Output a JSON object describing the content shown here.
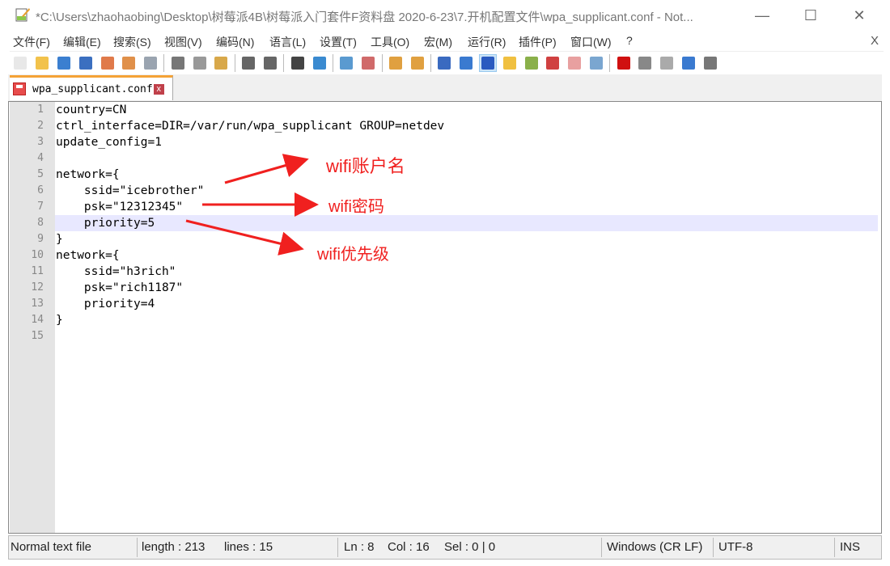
{
  "window": {
    "title": "*C:\\Users\\zhaohaobing\\Desktop\\树莓派4B\\树莓派入门套件F资料盘 2020-6-23\\7.开机配置文件\\wpa_supplicant.conf - Not...",
    "minimize": "—",
    "maximize": "☐",
    "close": "✕"
  },
  "menu": [
    "文件(F)",
    "编辑(E)",
    "搜索(S)",
    "视图(V)",
    "编码(N)",
    "语言(L)",
    "设置(T)",
    "工具(O)",
    "宏(M)",
    "运行(R)",
    "插件(P)",
    "窗口(W)",
    "?"
  ],
  "menu_close": "X",
  "toolbar": [
    {
      "name": "new-file-icon",
      "color": "#e8e8e8"
    },
    {
      "name": "open-file-icon",
      "color": "#f2c24b"
    },
    {
      "name": "save-icon",
      "color": "#3b7fd0"
    },
    {
      "name": "save-all-icon",
      "color": "#3b6fc0"
    },
    {
      "name": "close-icon",
      "color": "#e07a4a"
    },
    {
      "name": "close-all-icon",
      "color": "#e0904a"
    },
    {
      "name": "print-icon",
      "color": "#9aa4b0"
    },
    "sep",
    {
      "name": "cut-icon",
      "color": "#777"
    },
    {
      "name": "copy-icon",
      "color": "#999"
    },
    {
      "name": "paste-icon",
      "color": "#d8a84a"
    },
    "sep",
    {
      "name": "undo-icon",
      "color": "#666"
    },
    {
      "name": "redo-icon",
      "color": "#666"
    },
    "sep",
    {
      "name": "find-icon",
      "color": "#444"
    },
    {
      "name": "replace-icon",
      "color": "#3a8ad0"
    },
    "sep",
    {
      "name": "zoom-in-icon",
      "color": "#5a9ad0"
    },
    {
      "name": "zoom-out-icon",
      "color": "#d06a6a"
    },
    "sep",
    {
      "name": "sync-vertical-icon",
      "color": "#e0a040"
    },
    {
      "name": "sync-horizontal-icon",
      "color": "#e0a040"
    },
    "sep",
    {
      "name": "word-wrap-icon",
      "color": "#3a6ac0"
    },
    {
      "name": "show-all-chars-icon",
      "color": "#3a7ad0"
    },
    {
      "name": "indent-guide-icon",
      "color": "#2a5ac0"
    },
    {
      "name": "doc-map-icon",
      "color": "#f0c040"
    },
    {
      "name": "function-list-icon",
      "color": "#8ab04a"
    },
    {
      "name": "folder-as-workspace-icon",
      "color": "#d04040"
    },
    {
      "name": "doc-list-icon",
      "color": "#e8a0a0"
    },
    {
      "name": "monitoring-icon",
      "color": "#7aa6d0"
    },
    "sep",
    {
      "name": "record-macro-icon",
      "color": "#d01010"
    },
    {
      "name": "stop-macro-icon",
      "color": "#888"
    },
    {
      "name": "play-macro-icon",
      "color": "#aaa"
    },
    {
      "name": "run-macro-multiple-icon",
      "color": "#3a7ad0"
    },
    {
      "name": "save-macro-icon",
      "color": "#777"
    }
  ],
  "tab": {
    "label": "wpa_supplicant.conf",
    "close": "x"
  },
  "editor": {
    "current_line": 8,
    "lines": [
      "country=CN",
      "ctrl_interface=DIR=/var/run/wpa_supplicant GROUP=netdev",
      "update_config=1",
      "",
      "network={",
      "    ssid=\"icebrother\"",
      "    psk=\"12312345\"",
      "    priority=5",
      "}",
      "network={",
      "    ssid=\"h3rich\"",
      "    psk=\"rich1187\"",
      "    priority=4",
      "}",
      ""
    ]
  },
  "annotations": {
    "color": "#f0201f",
    "labels": [
      "wifi账户名",
      "wifi密码",
      "wifi优先级"
    ]
  },
  "status": {
    "type": "Normal text file",
    "length": "length : 213",
    "lines": "lines : 15",
    "ln": "Ln : 8",
    "col": "Col : 16",
    "sel": "Sel : 0 | 0",
    "eol": "Windows (CR LF)",
    "encoding": "UTF-8",
    "mode": "INS"
  }
}
